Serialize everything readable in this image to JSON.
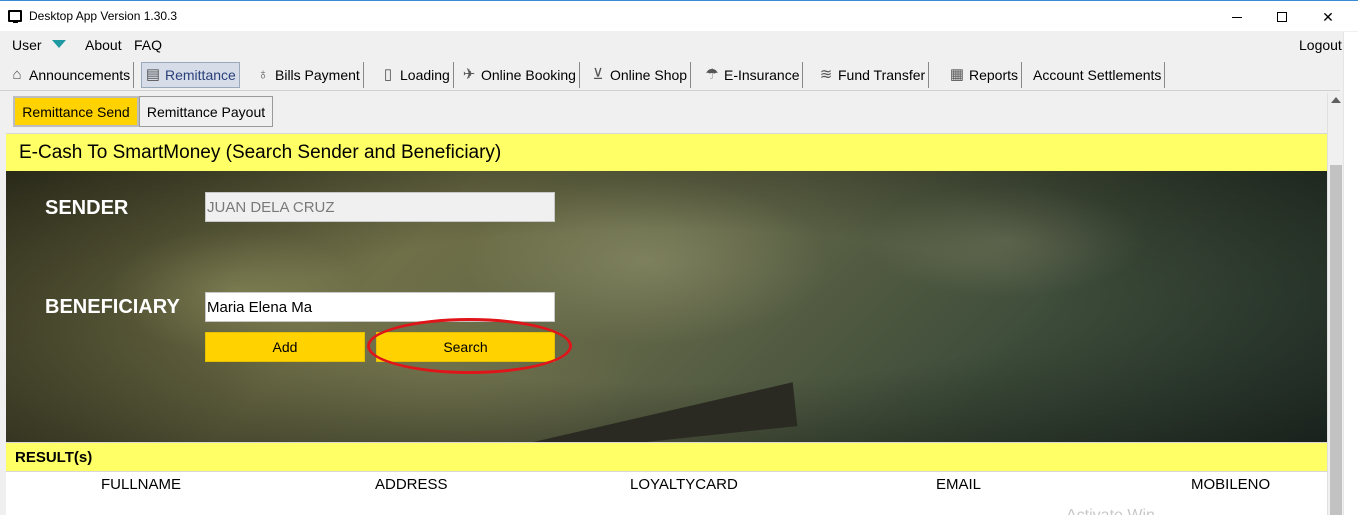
{
  "window": {
    "title": "Desktop App Version 1.30.3",
    "controls": {
      "minimize": "minimize",
      "maximize": "maximize",
      "close": "✕"
    }
  },
  "menubar": {
    "user": "User",
    "about": "About",
    "faq": "FAQ",
    "logout": "Logout"
  },
  "main_tabs": [
    {
      "label": "Announcements",
      "icon": "home-icon"
    },
    {
      "label": "Remittance",
      "icon": "remittance-icon",
      "active": true
    },
    {
      "label": "Bills Payment",
      "icon": "money-bag-icon"
    },
    {
      "label": "Loading",
      "icon": "phone-icon"
    },
    {
      "label": "Online Booking",
      "icon": "airplane-icon"
    },
    {
      "label": "Online Shop",
      "icon": "cart-icon"
    },
    {
      "label": "E-Insurance",
      "icon": "umbrella-person-icon"
    },
    {
      "label": "Fund Transfer",
      "icon": "cash-stack-icon"
    },
    {
      "label": "Reports",
      "icon": "report-icon"
    },
    {
      "label": "Account Settlements",
      "icon": ""
    }
  ],
  "sub_tabs": {
    "send": "Remittance Send",
    "payout": "Remittance Payout"
  },
  "page": {
    "header": "E-Cash To SmartMoney (Search Sender and Beneficiary)",
    "sender_label": "SENDER",
    "sender_value": "JUAN DELA CRUZ",
    "beneficiary_label": "BENEFICIARY",
    "beneficiary_value": "Maria Elena Ma",
    "add_button": "Add",
    "search_button": "Search"
  },
  "results": {
    "title": "RESULT(s)",
    "columns": [
      "FULLNAME",
      "ADDRESS",
      "LOYALTYCARD",
      "EMAIL",
      "MOBILENO"
    ]
  },
  "watermark": "Activate Win",
  "colors": {
    "accent_yellow": "#ffd200",
    "header_yellow": "#ffff66",
    "highlight_ring": "#e0151a",
    "caret_teal": "#1f9aa3"
  }
}
